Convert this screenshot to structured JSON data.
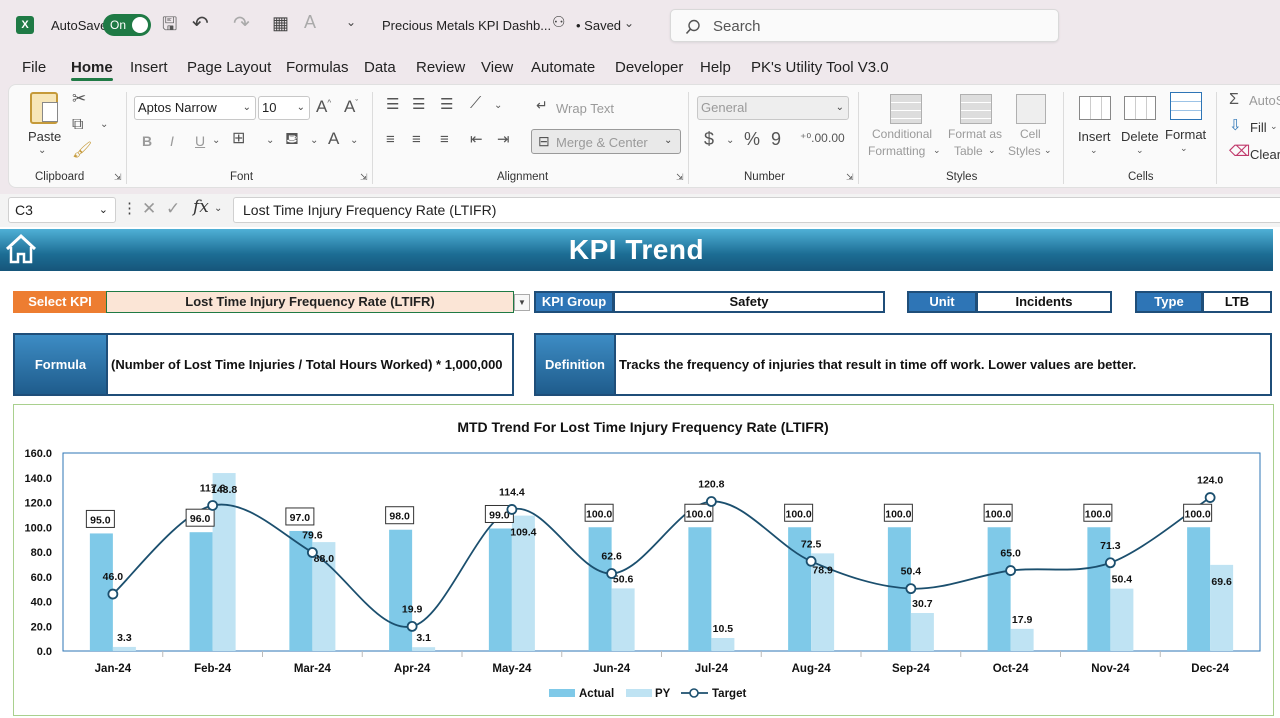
{
  "titlebar": {
    "autosave_label": "AutoSave",
    "autosave_state": "On",
    "doc_title": "Precious Metals KPI Dashb...",
    "saved_status": "• Saved",
    "search_placeholder": "Search"
  },
  "menu": [
    "File",
    "Home",
    "Insert",
    "Page Layout",
    "Formulas",
    "Data",
    "Review",
    "View",
    "Automate",
    "Developer",
    "Help",
    "PK's Utility Tool V3.0"
  ],
  "ribbon": {
    "clipboard": {
      "paste": "Paste",
      "label": "Clipboard"
    },
    "font": {
      "name": "Aptos Narrow",
      "size": "10",
      "bold": "B",
      "italic": "I",
      "underline": "U",
      "label": "Font"
    },
    "alignment": {
      "wrap": "Wrap Text",
      "merge": "Merge & Center",
      "label": "Alignment"
    },
    "number": {
      "format": "General",
      "label": "Number"
    },
    "styles": {
      "conditional": "Conditional",
      "conditional2": "Formatting",
      "format_as": "Format as",
      "format_as2": "Table",
      "cell": "Cell",
      "cell2": "Styles",
      "label": "Styles"
    },
    "cells": {
      "insert": "Insert",
      "delete": "Delete",
      "format": "Format",
      "label": "Cells"
    },
    "editing": {
      "autosum": "AutoS",
      "fill": "Fill",
      "clear": "Clear"
    }
  },
  "formula_bar": {
    "name_box": "C3",
    "fx": "fx",
    "content": "Lost Time Injury Frequency Rate (LTIFR)"
  },
  "dashboard": {
    "title": "KPI Trend",
    "select_kpi_label": "Select KPI",
    "select_kpi_value": "Lost Time Injury Frequency Rate (LTIFR)",
    "kpi_group_label": "KPI Group",
    "kpi_group_value": "Safety",
    "unit_label": "Unit",
    "unit_value": "Incidents",
    "type_label": "Type",
    "type_value": "LTB",
    "formula_label": "Formula",
    "formula_value": "(Number of Lost Time Injuries / Total Hours Worked) * 1,000,000",
    "definition_label": "Definition",
    "definition_value": "Tracks the frequency of injuries that result in time off work. Lower values are better.",
    "colors": {
      "select_label": "#ed7d31",
      "blue_label": "#2e75b6",
      "dark_border": "#1f4e79",
      "banner": "#1c6d94"
    }
  },
  "chart_data": {
    "type": "bar",
    "title": "MTD Trend For Lost Time Injury Frequency Rate (LTIFR)",
    "categories": [
      "Jan-24",
      "Feb-24",
      "Mar-24",
      "Apr-24",
      "May-24",
      "Jun-24",
      "Jul-24",
      "Aug-24",
      "Sep-24",
      "Oct-24",
      "Nov-24",
      "Dec-24"
    ],
    "series": [
      {
        "name": "Actual",
        "kind": "bar",
        "color": "#7fc9e8",
        "values": [
          95.0,
          96.0,
          97.0,
          98.0,
          99.0,
          100.0,
          100.0,
          100.0,
          100.0,
          100.0,
          100.0,
          100.0
        ]
      },
      {
        "name": "PY",
        "kind": "bar",
        "color": "#bfe3f3",
        "values": [
          3.3,
          143.8,
          88.0,
          3.1,
          109.4,
          50.6,
          10.5,
          78.9,
          30.7,
          17.9,
          50.4,
          69.6
        ]
      },
      {
        "name": "Target",
        "kind": "line",
        "color": "#1b4f6e",
        "values": [
          46.0,
          117.6,
          79.6,
          19.9,
          114.4,
          62.6,
          120.8,
          72.5,
          50.4,
          65.0,
          71.3,
          124.0
        ]
      }
    ],
    "ylim": [
      0,
      160
    ],
    "yticks": [
      "0.0",
      "20.0",
      "40.0",
      "60.0",
      "80.0",
      "100.0",
      "120.0",
      "140.0",
      "160.0"
    ],
    "grid": false,
    "legend": "bottom"
  }
}
